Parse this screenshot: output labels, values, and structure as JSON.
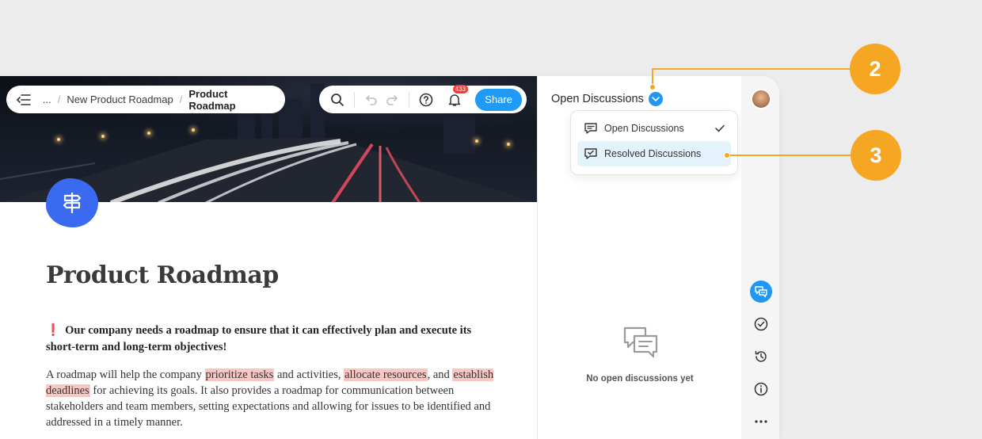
{
  "toolbar": {
    "ellipsis": "...",
    "breadcrumb_parent": "New Product Roadmap",
    "breadcrumb_current": "Product Roadmap",
    "notification_count": "433",
    "share_label": "Share"
  },
  "document": {
    "title": "Product Roadmap",
    "callout": "Our company needs a roadmap to ensure that it can effectively plan and execute its short-term and long-term objectives!",
    "paragraph": {
      "p1": "A roadmap will help the company ",
      "h1": "prioritize tasks",
      "p2": " and activities, ",
      "h2": "allocate resources",
      "p3": ", and ",
      "h3": "establish deadlines",
      "p4": " for achieving its goals. It also provides a roadmap for communication between stakeholders and team members, setting expectations and allowing for issues to be identified and addressed in a timely manner."
    }
  },
  "discussions": {
    "header": "Open Discussions",
    "dropdown": [
      {
        "label": "Open Discussions",
        "selected": true
      },
      {
        "label": "Resolved Discussions",
        "selected": false,
        "hovered": true
      }
    ],
    "empty_text": "No open discussions yet"
  },
  "annotations": {
    "a2": "2",
    "a3": "3"
  },
  "colors": {
    "accent": "#2196f3",
    "annotation": "#f5a623",
    "highlight": "#f8c7c3",
    "doc_icon": "#3a6af0"
  }
}
